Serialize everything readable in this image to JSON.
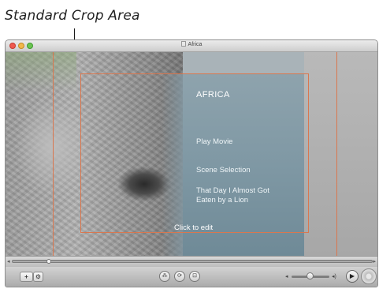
{
  "caption": {
    "text": "Standard Crop Area"
  },
  "window": {
    "title": "Africa"
  },
  "menu": {
    "title": "AFRICA",
    "items": [
      {
        "label": "Play Movie"
      },
      {
        "label": "Scene Selection"
      },
      {
        "label": "That Day I Almost Got Eaten by a Lion"
      }
    ],
    "hint": "Click to edit"
  },
  "toolbar": {
    "add_label": "+",
    "settings_icon": "gear-icon",
    "center_buttons": [
      {
        "icon": "network-icon",
        "glyph": "⁂"
      },
      {
        "icon": "loop-icon",
        "glyph": "⟳"
      },
      {
        "icon": "record-icon",
        "glyph": "⊡"
      }
    ],
    "play_glyph": "▶",
    "colors": {
      "crop_guides": "#d9774f",
      "menu_panel": "#7f98a4",
      "close": "#ef5a4f",
      "minimize": "#f2b84a",
      "zoom": "#6bc452"
    }
  }
}
